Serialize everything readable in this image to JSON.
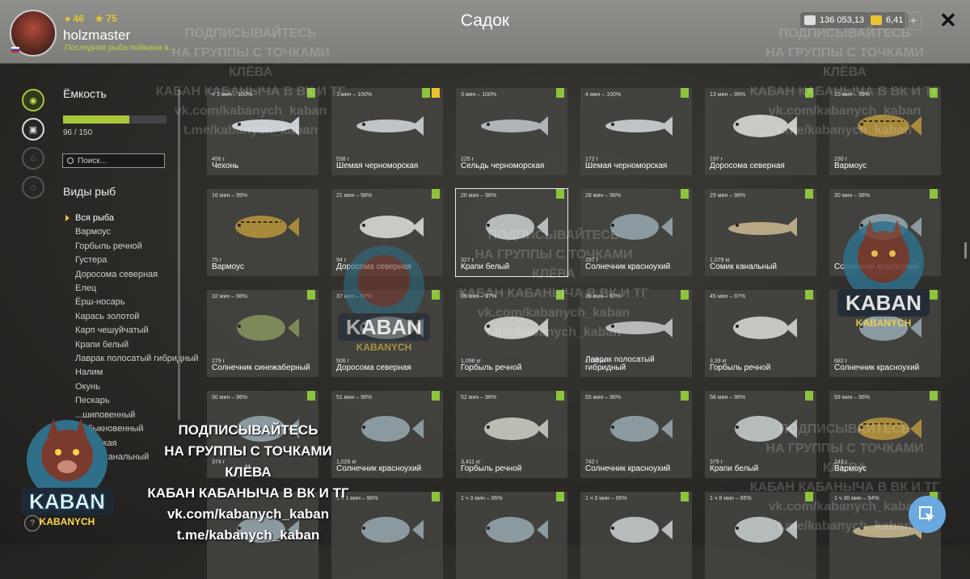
{
  "header": {
    "title": "Садок",
    "username": "holzmaster",
    "level_badge": "46",
    "stars": "75",
    "subtitle": "Последняя рыба поймана в...",
    "silver": "136 053,13",
    "gold": "6,41",
    "plus_label": "+",
    "close_label": "✕"
  },
  "sidebar": {
    "capacity_label": "Ёмкость",
    "capacity_used": 96,
    "capacity_total": 150,
    "capacity_text": "96 / 150",
    "search_placeholder": "Поиск...",
    "species_title": "Виды рыб",
    "species": [
      "Вся рыба",
      "Вармоус",
      "Горбыль речной",
      "Густера",
      "Доросома северная",
      "Елец",
      "Ёрш-носарь",
      "Карась золотой",
      "Карп чешуйчатый",
      "Крапи белый",
      "Лаврак полосатый гибридный",
      "Налим",
      "Окунь",
      "Пескарь",
      "...шиповенный",
      "...обыкновенный",
      "...морская",
      "",
      "",
      "Сомик канальный"
    ],
    "help_label": "?"
  },
  "cards": [
    {
      "time": "< 1 мин – 100%",
      "weight": "456 г",
      "name": "Чехонь",
      "color": "#c9cfd3",
      "shape": "slim",
      "checks": 1
    },
    {
      "time": "1 мин – 100%",
      "weight": "538 г",
      "name": "Шемая черноморская",
      "color": "#bfc4c6",
      "shape": "slim",
      "checks": 2
    },
    {
      "time": "3 мин – 100%",
      "weight": "225 г",
      "name": "Сельдь черноморская",
      "color": "#aeb4b8",
      "shape": "slim",
      "checks": 1
    },
    {
      "time": "4 мин – 100%",
      "weight": "172 г",
      "name": "Шемая черноморская",
      "color": "#bfc4c6",
      "shape": "slim",
      "checks": 1
    },
    {
      "time": "13 мин – 99%",
      "weight": "197 г",
      "name": "Доросома северная",
      "color": "#c8cbc4",
      "shape": "deep",
      "checks": 1
    },
    {
      "time": "15 мин – 99%",
      "weight": "230 г",
      "name": "Вармоус",
      "color": "#a88a3c",
      "shape": "bass",
      "checks": 1
    },
    {
      "time": "16 мин – 99%",
      "weight": "75 г",
      "name": "Вармоус",
      "color": "#a88a3c",
      "shape": "bass",
      "checks": 0
    },
    {
      "time": "21 мин – 98%",
      "weight": "94 г",
      "name": "Доросома северная",
      "color": "#c8cbc4",
      "shape": "deep",
      "checks": 1
    },
    {
      "time": "26 мин – 98%",
      "weight": "327 г",
      "name": "Крапи белый",
      "color": "#b6bcbc",
      "shape": "round",
      "checks": 1,
      "selected": true
    },
    {
      "time": "28 мин – 98%",
      "weight": "297 г",
      "name": "Солнечник красноухий",
      "color": "#8a9aa0",
      "shape": "round",
      "checks": 1
    },
    {
      "time": "29 мин – 98%",
      "weight": "1,079 кг",
      "name": "Сомик канальный",
      "color": "#b8a886",
      "shape": "cat",
      "checks": 1
    },
    {
      "time": "30 мин – 98%",
      "weight": "",
      "name": "Солнечник красноухий",
      "color": "#8a9aa0",
      "shape": "round",
      "checks": 1
    },
    {
      "time": "32 мин – 98%",
      "weight": "279 г",
      "name": "Солнечник синежаберный",
      "color": "#7c8a5a",
      "shape": "round",
      "checks": 1
    },
    {
      "time": "37 мин – 97%",
      "weight": "506 г",
      "name": "Доросома северная",
      "color": "#c8cbc4",
      "shape": "deep",
      "checks": 1
    },
    {
      "time": "39 мин – 97%",
      "weight": "1,098 кг",
      "name": "Горбыль речной",
      "color": "#c5c6c2",
      "shape": "deep",
      "checks": 1
    },
    {
      "time": "39 мин – 97%",
      "weight": "1,192 кг",
      "name": "Лаврак полосатый гибридный",
      "color": "#b6b9b6",
      "shape": "slim",
      "checks": 1
    },
    {
      "time": "45 мин – 97%",
      "weight": "3,39 кг",
      "name": "Горбыль речной",
      "color": "#c5c6c2",
      "shape": "deep",
      "checks": 1
    },
    {
      "time": "",
      "weight": "682 г",
      "name": "Солнечник красноухий",
      "color": "#8a9aa0",
      "shape": "round",
      "checks": 1
    },
    {
      "time": "50 мин – 96%",
      "weight": "374 г",
      "name": "",
      "color": "#8a9aa0",
      "shape": "round",
      "checks": 1
    },
    {
      "time": "51 мин – 96%",
      "weight": "1,026 кг",
      "name": "Солнечник красноухий",
      "color": "#8a9aa0",
      "shape": "round",
      "checks": 1
    },
    {
      "time": "52 мин – 96%",
      "weight": "3,411 кг",
      "name": "Горбыль речной",
      "color": "#bcbcb2",
      "shape": "deep",
      "checks": 1
    },
    {
      "time": "55 мин – 96%",
      "weight": "742 г",
      "name": "Солнечник красноухий",
      "color": "#8a9aa0",
      "shape": "round",
      "checks": 1
    },
    {
      "time": "58 мин – 96%",
      "weight": "379 г",
      "name": "Крапи белый",
      "color": "#b6bcbc",
      "shape": "round",
      "checks": 1
    },
    {
      "time": "59 мин – 96%",
      "weight": "243 г",
      "name": "Вармоус",
      "color": "#a88a3c",
      "shape": "bass",
      "checks": 1
    },
    {
      "time": "",
      "weight": "",
      "name": "",
      "color": "#8a9aa0",
      "shape": "round",
      "checks": 0
    },
    {
      "time": "1 ч 1 мин – 96%",
      "weight": "",
      "name": "",
      "color": "#8a9aa0",
      "shape": "round",
      "checks": 1
    },
    {
      "time": "1 ч 3 мин – 96%",
      "weight": "",
      "name": "",
      "color": "#8a9aa0",
      "shape": "round",
      "checks": 1
    },
    {
      "time": "1 ч 3 мин – 96%",
      "weight": "",
      "name": "",
      "color": "#b6bcbc",
      "shape": "round",
      "checks": 1
    },
    {
      "time": "1 ч 8 мин – 95%",
      "weight": "",
      "name": "",
      "color": "#b6bcbc",
      "shape": "round",
      "checks": 1
    },
    {
      "time": "1 ч 30 мин – 94%",
      "weight": "",
      "name": "",
      "color": "#b8a886",
      "shape": "cat",
      "checks": 1
    }
  ],
  "watermark": {
    "line1": "ПОДПИСЫВАЙТЕСЬ",
    "line2": "НА ГРУППЫ С ТОЧКАМИ КЛЁВА",
    "line3": "КАБАН КАБАНЫЧА В ВК И ТГ",
    "line4": "vk.com/kabanych_kaban",
    "line5": "t.me/kabanych_kaban",
    "logo_text1": "KABAN",
    "logo_text2": "KABANYCH"
  },
  "colors": {
    "accent": "#a8c83a",
    "gold": "#e8c530",
    "check": "#8cc43c",
    "fab": "#6aa9e0"
  }
}
